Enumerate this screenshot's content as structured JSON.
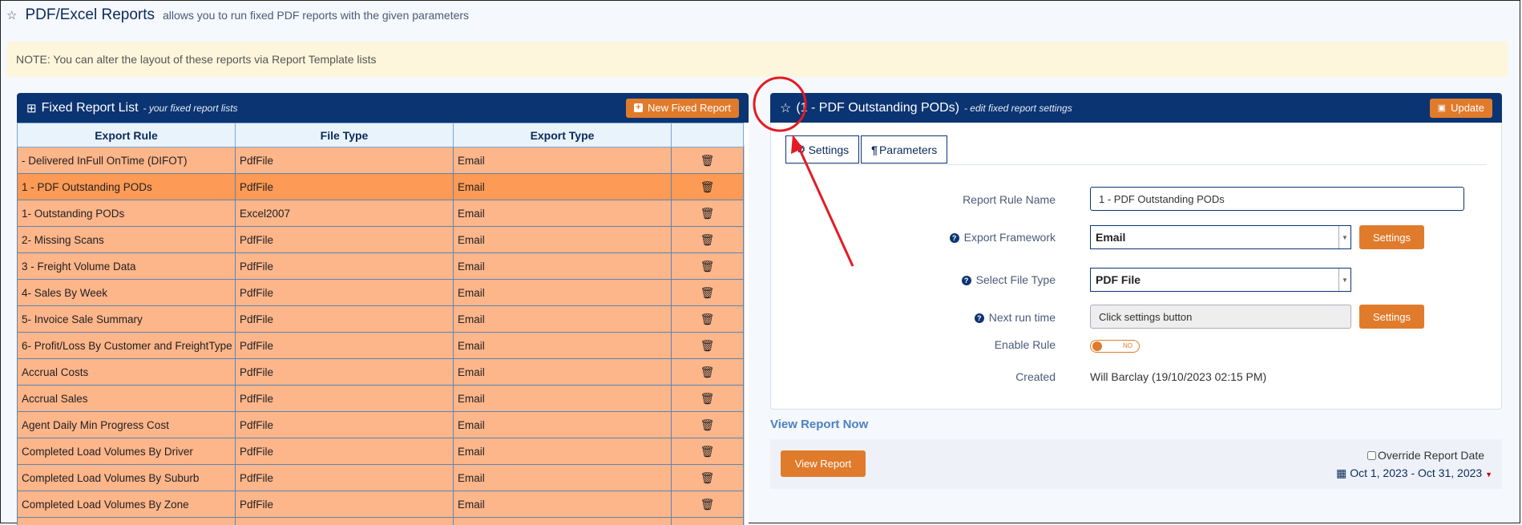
{
  "page": {
    "title": "PDF/Excel Reports",
    "subtitle": "allows you to run fixed PDF reports with the given parameters",
    "note": "NOTE: You can alter the layout of these reports via Report Template lists"
  },
  "left_panel": {
    "title": "Fixed Report List",
    "subtitle": "- your fixed report lists",
    "new_button": "New Fixed Report",
    "columns": [
      "Export Rule",
      "File Type",
      "Export Type",
      ""
    ],
    "rows": [
      {
        "rule": "- Delivered InFull OnTime (DIFOT)",
        "file": "PdfFile",
        "export": "Email"
      },
      {
        "rule": "1 - PDF Outstanding PODs",
        "file": "PdfFile",
        "export": "Email"
      },
      {
        "rule": "1- Outstanding PODs",
        "file": "Excel2007",
        "export": "Email"
      },
      {
        "rule": "2- Missing Scans",
        "file": "PdfFile",
        "export": "Email"
      },
      {
        "rule": "3 - Freight Volume Data",
        "file": "PdfFile",
        "export": "Email"
      },
      {
        "rule": "4- Sales By Week",
        "file": "PdfFile",
        "export": "Email"
      },
      {
        "rule": "5- Invoice Sale Summary",
        "file": "PdfFile",
        "export": "Email"
      },
      {
        "rule": "6- Profit/Loss By Customer and FreightType",
        "file": "PdfFile",
        "export": "Email"
      },
      {
        "rule": "Accrual Costs",
        "file": "PdfFile",
        "export": "Email"
      },
      {
        "rule": "Accrual Sales",
        "file": "PdfFile",
        "export": "Email"
      },
      {
        "rule": "Agent Daily Min Progress Cost",
        "file": "PdfFile",
        "export": "Email"
      },
      {
        "rule": "Completed Load Volumes By Driver",
        "file": "PdfFile",
        "export": "Email"
      },
      {
        "rule": "Completed Load Volumes By Suburb",
        "file": "PdfFile",
        "export": "Email"
      },
      {
        "rule": "Completed Load Volumes By Zone",
        "file": "PdfFile",
        "export": "Email"
      },
      {
        "rule": "",
        "file": "",
        "export": ""
      }
    ],
    "selected_index": 1
  },
  "right_panel": {
    "title": "(1 - PDF Outstanding PODs)",
    "subtitle": "- edit fixed report settings",
    "update_button": "Update",
    "tabs": [
      "Settings",
      "Parameters"
    ],
    "fields": {
      "rule_name_label": "Report Rule Name",
      "rule_name_value": "1 - PDF Outstanding PODs",
      "framework_label": "Export Framework",
      "framework_value": "Email",
      "framework_button": "Settings",
      "file_type_label": "Select File Type",
      "file_type_value": "PDF File",
      "next_run_label": "Next run time",
      "next_run_value": "Click settings button",
      "next_run_button": "Settings",
      "enable_label": "Enable Rule",
      "enable_state": "NO",
      "created_label": "Created",
      "created_value": "Will Barclay (19/10/2023 02:15 PM)"
    }
  },
  "view_report": {
    "heading": "View Report Now",
    "button": "View Report",
    "override_label": "Override Report Date",
    "date_range": "Oct 1, 2023 - Oct 31, 2023"
  },
  "colors": {
    "header_navy": "#0b3472",
    "accent_orange": "#e07b2c",
    "row_orange": "#fdb58a",
    "selected_row": "#fd9a55",
    "annotation_red": "#e31b23"
  }
}
